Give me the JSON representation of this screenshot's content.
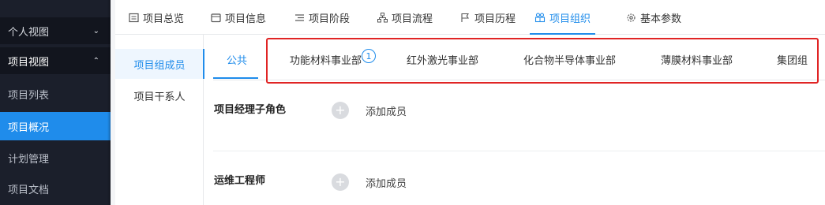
{
  "sidebar": {
    "items": [
      {
        "label": "个人视图",
        "chevron": "chevron-down-icon",
        "type": "group"
      },
      {
        "label": "项目视图",
        "chevron": "chevron-up-icon",
        "type": "group-expanded"
      },
      {
        "label": "项目列表",
        "type": "item"
      },
      {
        "label": "项目概况",
        "type": "item-active"
      },
      {
        "label": "计划管理",
        "type": "item"
      },
      {
        "label": "项目文档",
        "type": "item"
      }
    ]
  },
  "top_tabs": [
    {
      "label": "项目总览",
      "icon": "overview-icon"
    },
    {
      "label": "项目信息",
      "icon": "info-icon"
    },
    {
      "label": "项目阶段",
      "icon": "stage-icon"
    },
    {
      "label": "项目流程",
      "icon": "flow-icon"
    },
    {
      "label": "项目历程",
      "icon": "flag-icon"
    },
    {
      "label": "项目组织",
      "icon": "org-icon",
      "active": true
    },
    {
      "label": "基本参数",
      "icon": "gear-icon"
    }
  ],
  "left_nav": [
    {
      "label": "项目组成员",
      "active": true
    },
    {
      "label": "项目干系人"
    }
  ],
  "sub_tabs": [
    {
      "label": "公共",
      "active": true
    },
    {
      "label": "功能材料事业部",
      "badge": "1"
    },
    {
      "label": "红外激光事业部"
    },
    {
      "label": "化合物半导体事业部"
    },
    {
      "label": "薄膜材料事业部"
    },
    {
      "label": "集团组"
    }
  ],
  "roles": [
    {
      "title": "项目经理子角色",
      "add_label": "添加成员"
    },
    {
      "title": "运维工程师",
      "add_label": "添加成员"
    }
  ],
  "colors": {
    "accent": "#1f8ceb",
    "sidebar_bg": "#1b1f2b",
    "highlight": "#e02424"
  }
}
